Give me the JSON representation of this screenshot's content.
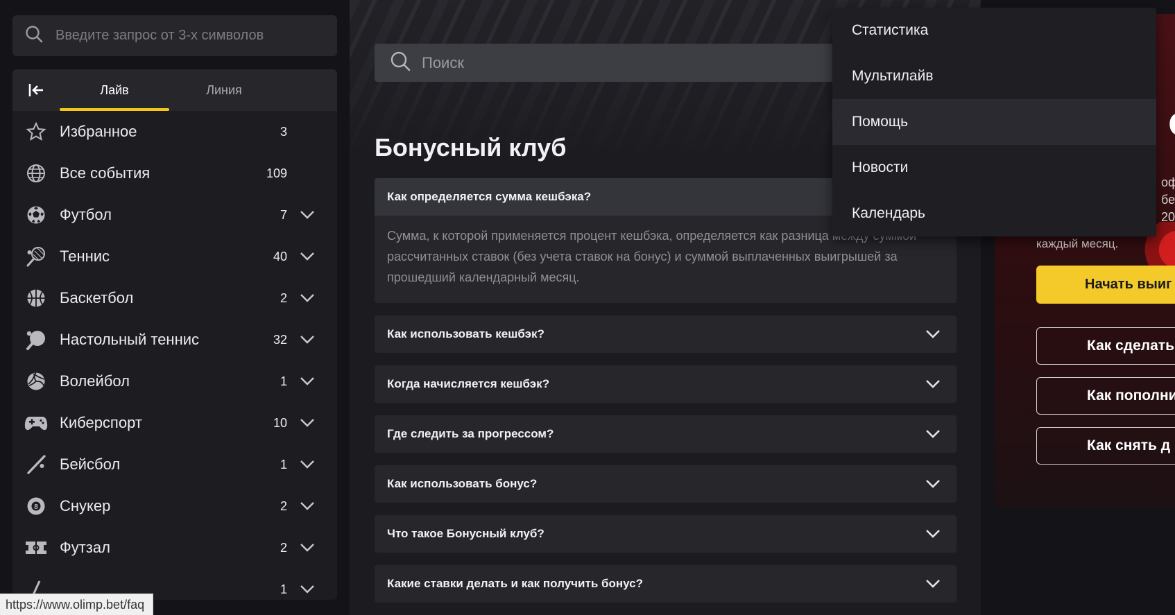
{
  "colors": {
    "accent": "#f5c518",
    "brand_red": "#c8101a",
    "panel": "#1c1c21"
  },
  "sidebar": {
    "search_placeholder": "Введите запрос от 3-х символов",
    "tabs": [
      {
        "label": "Лайв",
        "active": true
      },
      {
        "label": "Линия",
        "active": false
      }
    ],
    "sports": [
      {
        "name": "Избранное",
        "count": "3",
        "icon": "star-icon",
        "expandable": false
      },
      {
        "name": "Все события",
        "count": "109",
        "icon": "globe-icon",
        "expandable": false
      },
      {
        "name": "Футбол",
        "count": "7",
        "icon": "football-icon",
        "expandable": true
      },
      {
        "name": "Теннис",
        "count": "40",
        "icon": "tennis-icon",
        "expandable": true
      },
      {
        "name": "Баскетбол",
        "count": "2",
        "icon": "basketball-icon",
        "expandable": true
      },
      {
        "name": "Настольный теннис",
        "count": "32",
        "icon": "table-tennis-icon",
        "expandable": true
      },
      {
        "name": "Волейбол",
        "count": "1",
        "icon": "volleyball-icon",
        "expandable": true
      },
      {
        "name": "Киберспорт",
        "count": "10",
        "icon": "gamepad-icon",
        "expandable": true
      },
      {
        "name": "Бейсбол",
        "count": "1",
        "icon": "baseball-icon",
        "expandable": true
      },
      {
        "name": "Снукер",
        "count": "2",
        "icon": "snooker-icon",
        "expandable": true
      },
      {
        "name": "Футзал",
        "count": "2",
        "icon": "futsal-icon",
        "expandable": true
      },
      {
        "name": "",
        "count": "1",
        "icon": "hockey-icon",
        "expandable": true
      }
    ]
  },
  "main": {
    "search_placeholder": "Поиск",
    "title": "Бонусный клуб",
    "faq_open": {
      "question": "Как определяется сумма кешбэка?",
      "answer": "Сумма, к которой применяется процент кешбэка, определяется как разница между суммой рассчитанных ставок (без учета ставок на бонус) и суммой выплаченных выигрышей за прошедший календарный месяц."
    },
    "faq": [
      "Как использовать кешбэк?",
      "Когда начисляется кешбэк?",
      "Где следить за прогрессом?",
      "Как использовать бонус?",
      "Что такое Бонусный клуб?",
      "Какие ставки делать и как получить бонус?"
    ]
  },
  "promo": {
    "logo_fragment": "ol",
    "side_text": [
      "офи",
      "бети",
      "20"
    ],
    "sub_fragment": "каждый месяц.",
    "start_button": "Начать выиг",
    "buttons": [
      "Как сделать",
      "Как пополни",
      "Как снять д"
    ]
  },
  "menu": {
    "items": [
      "Статистика",
      "Мультилайв",
      "Помощь",
      "Новости",
      "Календарь"
    ],
    "hovered": "Помощь"
  },
  "status_bar": {
    "url": "https://www.olimp.bet/faq"
  }
}
